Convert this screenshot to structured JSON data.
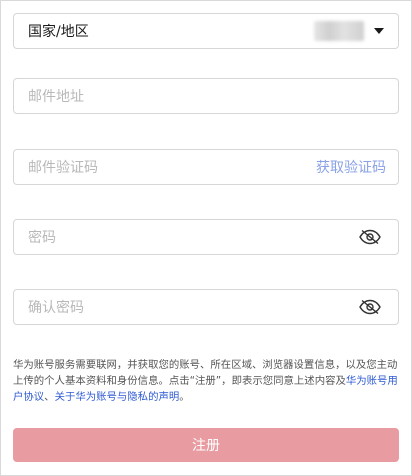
{
  "country": {
    "label": "国家/地区"
  },
  "email": {
    "placeholder": "邮件地址"
  },
  "code": {
    "placeholder": "邮件验证码",
    "get_code": "获取验证码"
  },
  "password": {
    "placeholder": "密码"
  },
  "confirm": {
    "placeholder": "确认密码"
  },
  "notice": {
    "text": "华为账号服务需要联网，并获取您的账号、所在区域、浏览器设置信息，以及您主动上传的个人基本资料和身份信息。点击“注册”，即表示您同意上述内容及",
    "link1": "华为账号用户协议",
    "sep": "、",
    "link2": "关于华为账号与隐私的声明",
    "end": "。"
  },
  "register": {
    "label": "注册"
  },
  "icons": {
    "eye_off": "eye-off-icon",
    "dropdown": "chevron-down-icon"
  },
  "colors": {
    "accent_link": "#2f5bd3",
    "button_disabled": "#e89ba0",
    "get_code": "#8aa2e6"
  }
}
